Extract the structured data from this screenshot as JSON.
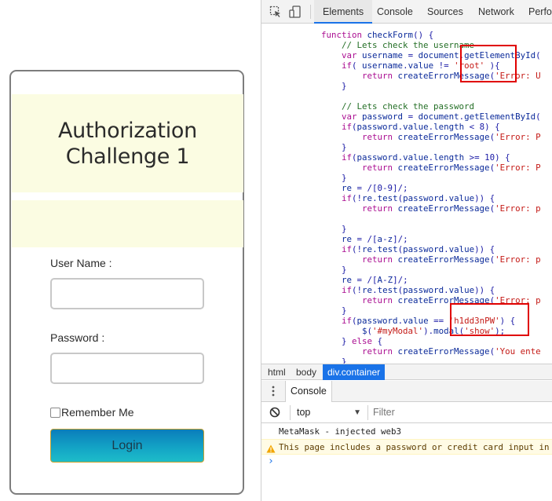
{
  "page": {
    "title_line1": "Authorization",
    "title_line2": "Challenge 1",
    "username_label": "User Name :",
    "username_value": "",
    "password_label": "Password :",
    "password_value": "",
    "remember_label": "Remember Me",
    "login_label": "Login"
  },
  "devtools": {
    "tabs": [
      "Elements",
      "Console",
      "Sources",
      "Network",
      "Perfor"
    ],
    "active_tab": "Elements",
    "code_lines": [
      "        function checkForm() {",
      "            // Lets check the username",
      "            var username = document.getElementById(",
      "            if( username.value != 'root' ){",
      "                return createErrorMessage('Error: U",
      "            }",
      "",
      "            // Lets check the password",
      "            var password = document.getElementById(",
      "            if(password.value.length < 8) {",
      "                return createErrorMessage('Error: P",
      "            }",
      "            if(password.value.length >= 10) {",
      "                return createErrorMessage('Error: P",
      "            }",
      "            re = /[0-9]/;",
      "            if(!re.test(password.value)) {",
      "                return createErrorMessage('Error: p",
      "",
      "            }",
      "            re = /[a-z]/;",
      "            if(!re.test(password.value)) {",
      "                return createErrorMessage('Error: p",
      "            }",
      "            re = /[A-Z]/;",
      "            if(!re.test(password.value)) {",
      "                return createErrorMessage('Error: p",
      "            }",
      "            if(password.value == 'h1dd3nPW') {",
      "                $('#myModal').modal('show');",
      "            } else {",
      "                return createErrorMessage('You ente",
      "            }"
    ],
    "breadcrumbs": [
      "html",
      "body",
      "div.container"
    ],
    "active_breadcrumb": "div.container",
    "console_tab": "Console",
    "context": "top",
    "filter_placeholder": "Filter",
    "console_messages": [
      {
        "level": "log",
        "text": "MetaMask - injected web3"
      },
      {
        "level": "warning",
        "text": "This page includes a password or credit card input in"
      }
    ],
    "prompt_symbol": "›"
  },
  "colors": {
    "highlight_box": "#e00000",
    "header_bg": "#fbfce2",
    "login_button": "#0a7dbb",
    "active_crumb": "#1a73e8"
  }
}
